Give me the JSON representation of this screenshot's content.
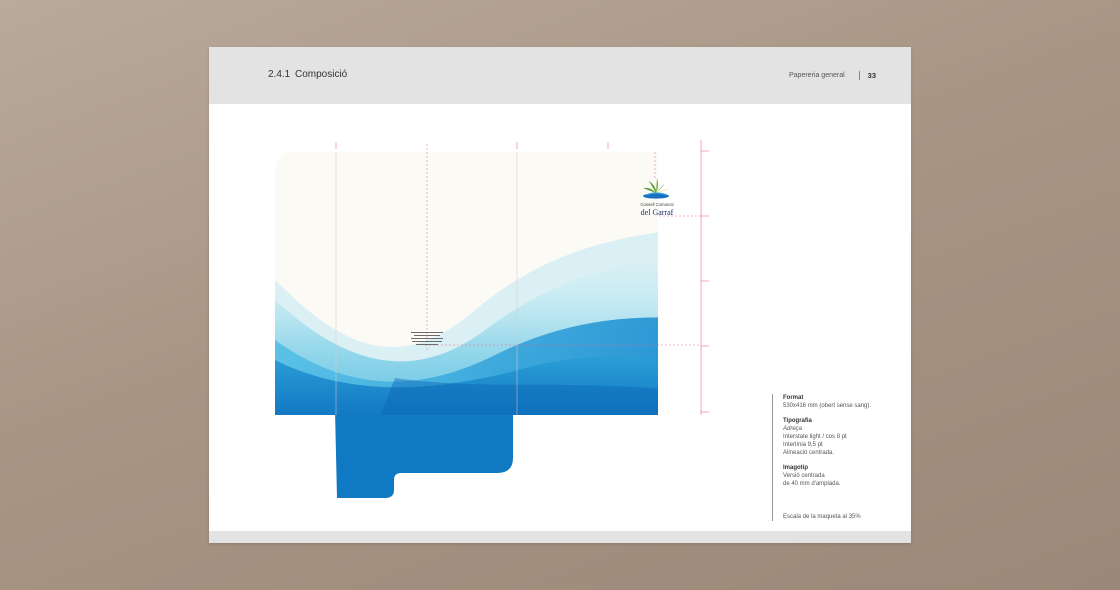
{
  "header": {
    "section_number": "2.4.1",
    "section_title": "Composició",
    "category": "Papereria general",
    "page_number": "33"
  },
  "folder": {
    "logo_line1": "Consell Comarcal",
    "logo_line2": "del Garraf",
    "colors": {
      "background": "#fbfaf5",
      "blue_dark": "#0f79c4",
      "blue_light": "#8fd6ea",
      "guide_pink": "#e86a94"
    }
  },
  "info": {
    "format_title": "Format",
    "format_value": "530x416 mm (obert sense sang).",
    "typography_title": "Tipografia",
    "typography_subtitle": "Adreça",
    "typography_line1": "Interstate light / cos 8 pt",
    "typography_line2": "Interlínia 9,5 pt",
    "typography_line3": "Alineació centrada.",
    "imagotip_title": "Imagotip",
    "imagotip_line1": "Versió centrada",
    "imagotip_line2": "de 40 mm d'amplada.",
    "scale": "Escala de la maqueta al 35%"
  }
}
